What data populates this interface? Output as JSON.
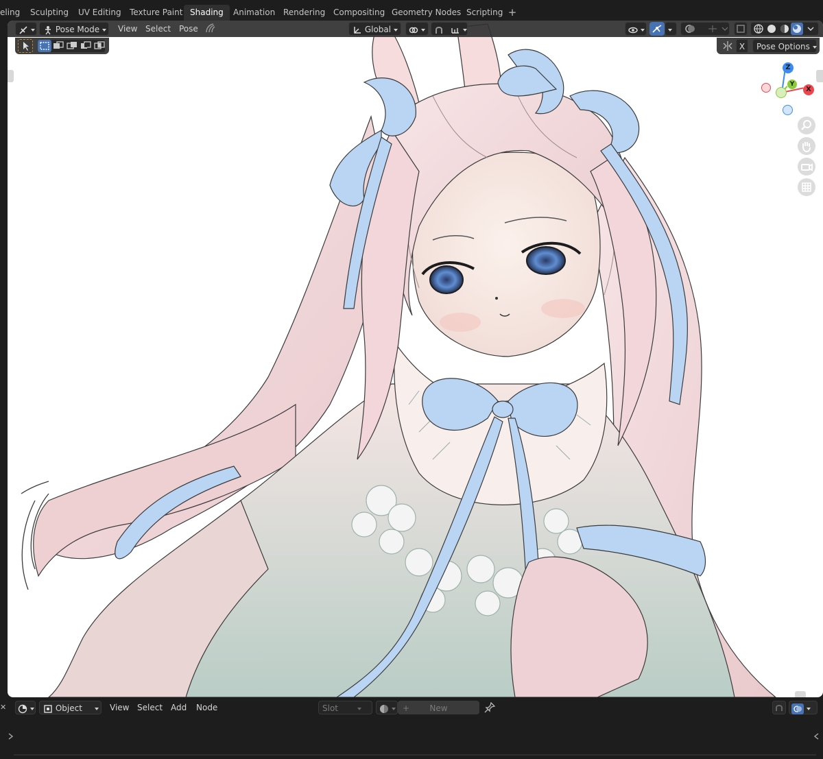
{
  "workspace_tabs": [
    {
      "label": "eling",
      "active": false
    },
    {
      "label": "Sculpting",
      "active": false
    },
    {
      "label": "UV Editing",
      "active": false
    },
    {
      "label": "Texture Paint",
      "active": false
    },
    {
      "label": "Shading",
      "active": true
    },
    {
      "label": "Animation",
      "active": false
    },
    {
      "label": "Rendering",
      "active": false
    },
    {
      "label": "Compositing",
      "active": false
    },
    {
      "label": "Geometry Nodes",
      "active": false
    },
    {
      "label": "Scripting",
      "active": false
    }
  ],
  "add_workspace_symbol": "+",
  "viewport_header": {
    "mode_label": "Pose Mode",
    "menus": [
      "View",
      "Select",
      "Pose"
    ],
    "transform_orientation": "Global",
    "pose_options_label": "Pose Options",
    "close_symbol": "X"
  },
  "gizmo": {
    "x": "X",
    "y": "Y",
    "z": "Z"
  },
  "node_editor_header": {
    "object_label": "Object",
    "menus": [
      "View",
      "Select",
      "Add",
      "Node"
    ],
    "slot_label": "Slot",
    "new_label": "New"
  },
  "colors": {
    "accent": "#4772b3",
    "axis_x": "#f0454f",
    "axis_y": "#8acb39",
    "axis_z": "#3a8cf0",
    "hair_pink": "#f4d7da",
    "ribbon_blue": "#b6d2f1"
  },
  "icons": {
    "editor_type": "armature-editor-icon",
    "mode": "pose-mode-icon",
    "orientation": "transform-orientation-icon",
    "pivot": "pivot-point-icon",
    "snap": "snap-icon",
    "overlays": "overlays-icon",
    "shading": "viewport-shading-icon"
  }
}
